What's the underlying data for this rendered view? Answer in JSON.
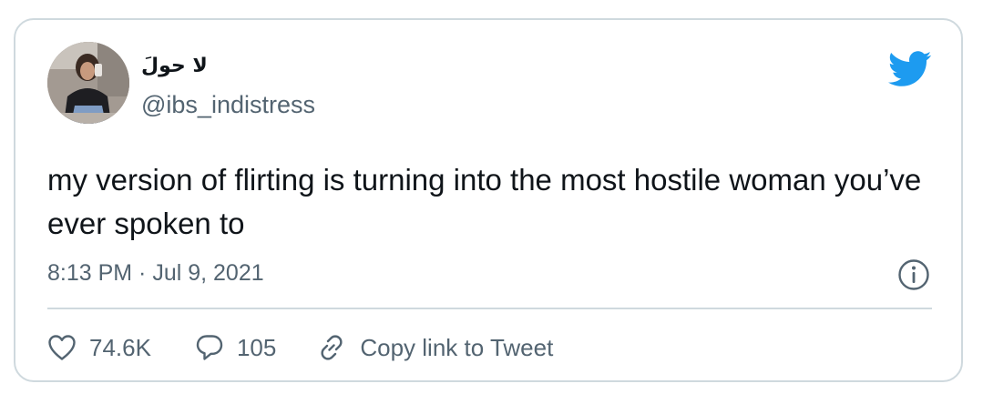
{
  "tweet": {
    "author": {
      "display_name": "لا حولَ",
      "handle": "@ibs_indistress",
      "avatar_icon": "user-photo-avatar"
    },
    "text": "my version of flirting is turning into the most hostile woman you’ve ever spoken to",
    "timestamp": "8:13 PM · Jul 9, 2021",
    "actions": {
      "likes": {
        "count": "74.6K",
        "icon": "heart-icon"
      },
      "replies": {
        "count": "105",
        "icon": "speech-bubble-icon"
      },
      "copy_link": {
        "label": "Copy link to Tweet",
        "icon": "link-icon"
      }
    }
  },
  "colors": {
    "brand": "#1d9bf0",
    "text_primary": "#0f1419",
    "text_secondary": "#536471",
    "border": "#cfd9de"
  }
}
